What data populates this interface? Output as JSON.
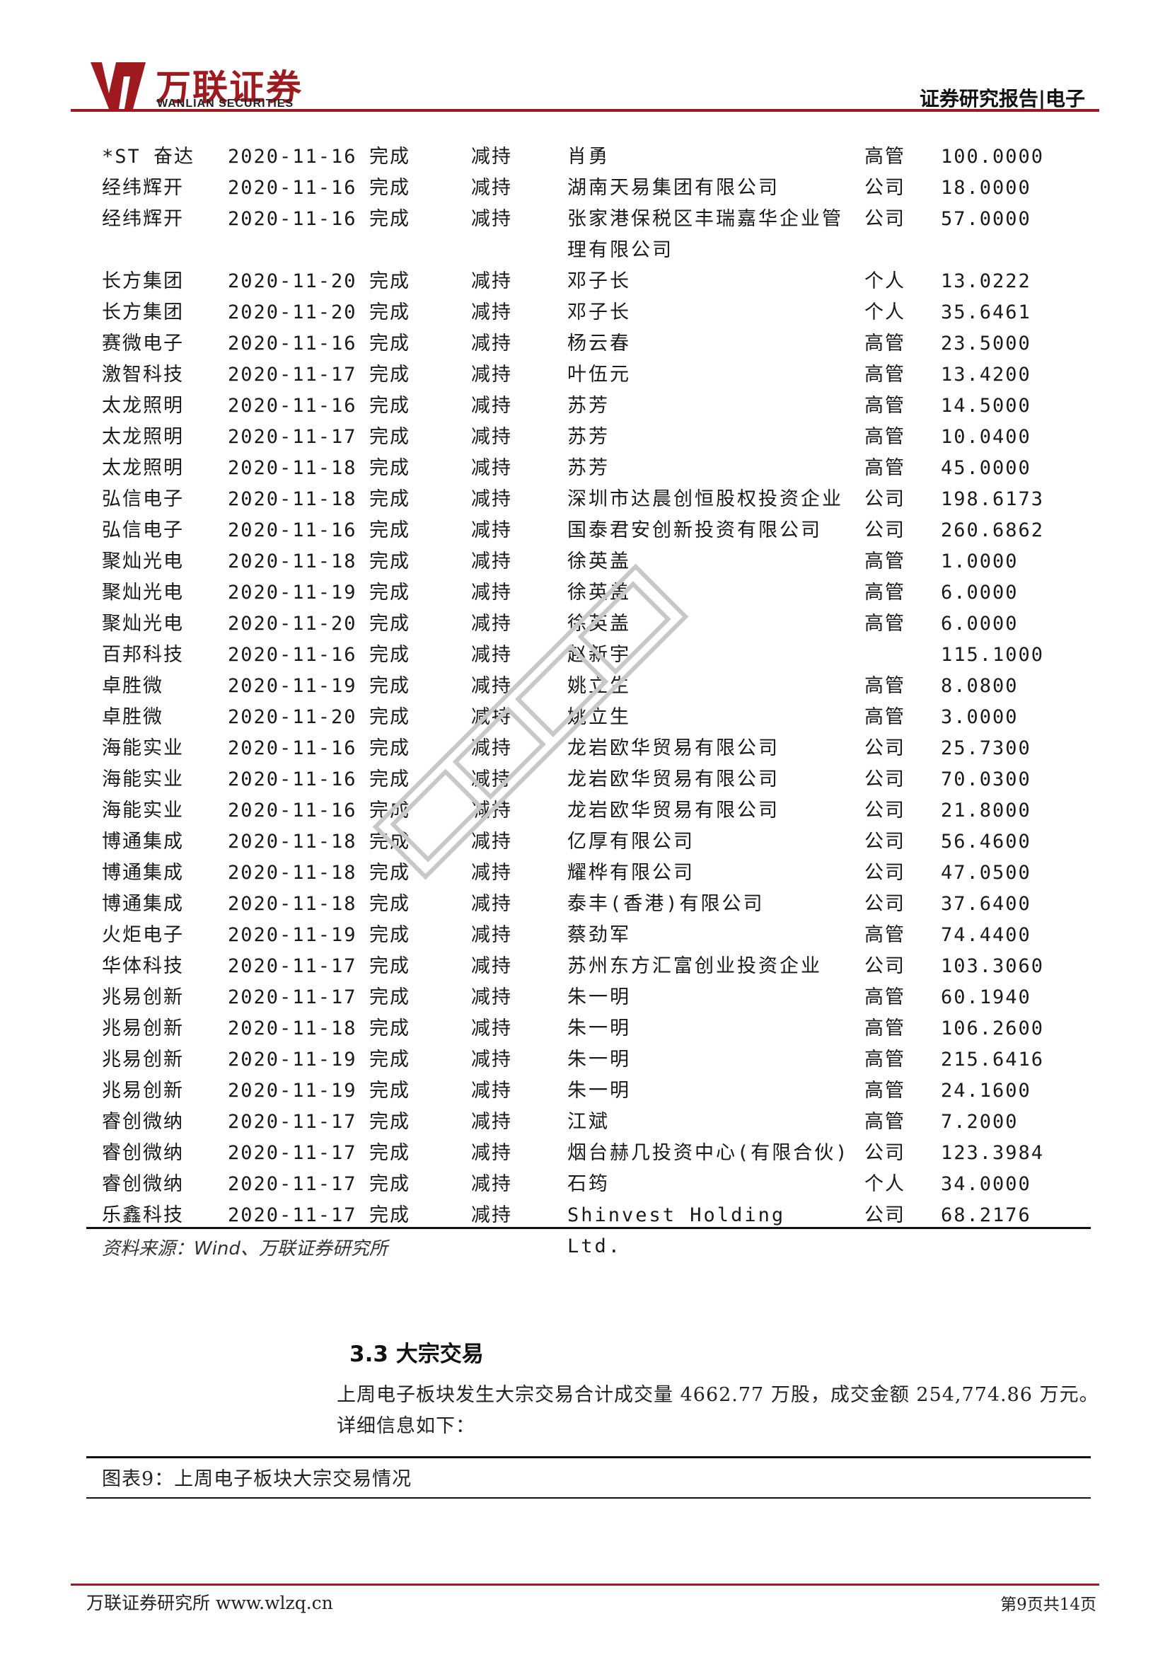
{
  "header": {
    "logo_cn": "万联证券",
    "logo_en": "WANLIAN SECURITIES",
    "section": "证券研究报告|电子"
  },
  "table": {
    "rows": [
      {
        "name": "*ST 奋达",
        "date": "2020-11-16",
        "status": "完成",
        "type": "减持",
        "holder": "肖勇",
        "holder_type": "高管",
        "amount": "100.0000"
      },
      {
        "name": "经纬辉开",
        "date": "2020-11-16",
        "status": "完成",
        "type": "减持",
        "holder": "湖南天易集团有限公司",
        "holder_type": "公司",
        "amount": "18.0000"
      },
      {
        "name": "经纬辉开",
        "date": "2020-11-16",
        "status": "完成",
        "type": "减持",
        "holder": "张家港保税区丰瑞嘉华企业管理有限公司",
        "holder_type": "公司",
        "amount": "57.0000"
      },
      {
        "name": "长方集团",
        "date": "2020-11-20",
        "status": "完成",
        "type": "减持",
        "holder": "邓子长",
        "holder_type": "个人",
        "amount": "13.0222"
      },
      {
        "name": "长方集团",
        "date": "2020-11-20",
        "status": "完成",
        "type": "减持",
        "holder": "邓子长",
        "holder_type": "个人",
        "amount": "35.6461"
      },
      {
        "name": "赛微电子",
        "date": "2020-11-16",
        "status": "完成",
        "type": "减持",
        "holder": "杨云春",
        "holder_type": "高管",
        "amount": "23.5000"
      },
      {
        "name": "激智科技",
        "date": "2020-11-17",
        "status": "完成",
        "type": "减持",
        "holder": "叶伍元",
        "holder_type": "高管",
        "amount": "13.4200"
      },
      {
        "name": "太龙照明",
        "date": "2020-11-16",
        "status": "完成",
        "type": "减持",
        "holder": "苏芳",
        "holder_type": "高管",
        "amount": "14.5000"
      },
      {
        "name": "太龙照明",
        "date": "2020-11-17",
        "status": "完成",
        "type": "减持",
        "holder": "苏芳",
        "holder_type": "高管",
        "amount": "10.0400"
      },
      {
        "name": "太龙照明",
        "date": "2020-11-18",
        "status": "完成",
        "type": "减持",
        "holder": "苏芳",
        "holder_type": "高管",
        "amount": "45.0000"
      },
      {
        "name": "弘信电子",
        "date": "2020-11-18",
        "status": "完成",
        "type": "减持",
        "holder": "深圳市达晨创恒股权投资企业",
        "holder_type": "公司",
        "amount": "198.6173"
      },
      {
        "name": "弘信电子",
        "date": "2020-11-16",
        "status": "完成",
        "type": "减持",
        "holder": "国泰君安创新投资有限公司",
        "holder_type": "公司",
        "amount": "260.6862"
      },
      {
        "name": "聚灿光电",
        "date": "2020-11-18",
        "status": "完成",
        "type": "减持",
        "holder": "徐英盖",
        "holder_type": "高管",
        "amount": "1.0000"
      },
      {
        "name": "聚灿光电",
        "date": "2020-11-19",
        "status": "完成",
        "type": "减持",
        "holder": "徐英盖",
        "holder_type": "高管",
        "amount": "6.0000"
      },
      {
        "name": "聚灿光电",
        "date": "2020-11-20",
        "status": "完成",
        "type": "减持",
        "holder": "徐英盖",
        "holder_type": "高管",
        "amount": "6.0000"
      },
      {
        "name": "百邦科技",
        "date": "2020-11-16",
        "status": "完成",
        "type": "减持",
        "holder": "赵新宇",
        "holder_type": "",
        "amount": "115.1000"
      },
      {
        "name": "卓胜微",
        "date": "2020-11-19",
        "status": "完成",
        "type": "减持",
        "holder": "姚立生",
        "holder_type": "高管",
        "amount": "8.0800"
      },
      {
        "name": "卓胜微",
        "date": "2020-11-20",
        "status": "完成",
        "type": "减持",
        "holder": "姚立生",
        "holder_type": "高管",
        "amount": "3.0000"
      },
      {
        "name": "海能实业",
        "date": "2020-11-16",
        "status": "完成",
        "type": "减持",
        "holder": "龙岩欧华贸易有限公司",
        "holder_type": "公司",
        "amount": "25.7300"
      },
      {
        "name": "海能实业",
        "date": "2020-11-16",
        "status": "完成",
        "type": "减持",
        "holder": "龙岩欧华贸易有限公司",
        "holder_type": "公司",
        "amount": "70.0300"
      },
      {
        "name": "海能实业",
        "date": "2020-11-16",
        "status": "完成",
        "type": "减持",
        "holder": "龙岩欧华贸易有限公司",
        "holder_type": "公司",
        "amount": "21.8000"
      },
      {
        "name": "博通集成",
        "date": "2020-11-18",
        "status": "完成",
        "type": "减持",
        "holder": "亿厚有限公司",
        "holder_type": "公司",
        "amount": "56.4600"
      },
      {
        "name": "博通集成",
        "date": "2020-11-18",
        "status": "完成",
        "type": "减持",
        "holder": "耀桦有限公司",
        "holder_type": "公司",
        "amount": "47.0500"
      },
      {
        "name": "博通集成",
        "date": "2020-11-18",
        "status": "完成",
        "type": "减持",
        "holder": "泰丰(香港)有限公司",
        "holder_type": "公司",
        "amount": "37.6400"
      },
      {
        "name": "火炬电子",
        "date": "2020-11-19",
        "status": "完成",
        "type": "减持",
        "holder": "蔡劲军",
        "holder_type": "高管",
        "amount": "74.4400"
      },
      {
        "name": "华体科技",
        "date": "2020-11-17",
        "status": "完成",
        "type": "减持",
        "holder": "苏州东方汇富创业投资企业",
        "holder_type": "公司",
        "amount": "103.3060"
      },
      {
        "name": "兆易创新",
        "date": "2020-11-17",
        "status": "完成",
        "type": "减持",
        "holder": "朱一明",
        "holder_type": "高管",
        "amount": "60.1940"
      },
      {
        "name": "兆易创新",
        "date": "2020-11-18",
        "status": "完成",
        "type": "减持",
        "holder": "朱一明",
        "holder_type": "高管",
        "amount": "106.2600"
      },
      {
        "name": "兆易创新",
        "date": "2020-11-19",
        "status": "完成",
        "type": "减持",
        "holder": "朱一明",
        "holder_type": "高管",
        "amount": "215.6416"
      },
      {
        "name": "兆易创新",
        "date": "2020-11-19",
        "status": "完成",
        "type": "减持",
        "holder": "朱一明",
        "holder_type": "高管",
        "amount": "24.1600"
      },
      {
        "name": "睿创微纳",
        "date": "2020-11-17",
        "status": "完成",
        "type": "减持",
        "holder": "江斌",
        "holder_type": "高管",
        "amount": "7.2000"
      },
      {
        "name": "睿创微纳",
        "date": "2020-11-17",
        "status": "完成",
        "type": "减持",
        "holder": "烟台赫几投资中心(有限合伙)",
        "holder_type": "公司",
        "amount": "123.3984"
      },
      {
        "name": "睿创微纳",
        "date": "2020-11-17",
        "status": "完成",
        "type": "减持",
        "holder": "石筠",
        "holder_type": "个人",
        "amount": "34.0000"
      },
      {
        "name": "乐鑫科技",
        "date": "2020-11-17",
        "status": "完成",
        "type": "减持",
        "holder": "Shinvest Holding Ltd.",
        "holder_type": "公司",
        "amount": "68.2176"
      }
    ]
  },
  "source": "资料来源：Wind、万联证券研究所",
  "section": {
    "title": "3.3 大宗交易",
    "paragraph": "上周电子板块发生大宗交易合计成交量 4662.77 万股，成交金额 254,774.86 万元。详细信息如下："
  },
  "figure": {
    "caption": "图表9：上周电子板块大宗交易情况"
  },
  "footer": {
    "left": "万联证券研究所 www.wlzq.cn",
    "right": "第9页共14页"
  },
  "colors": {
    "brand": "#9e1a1f"
  }
}
